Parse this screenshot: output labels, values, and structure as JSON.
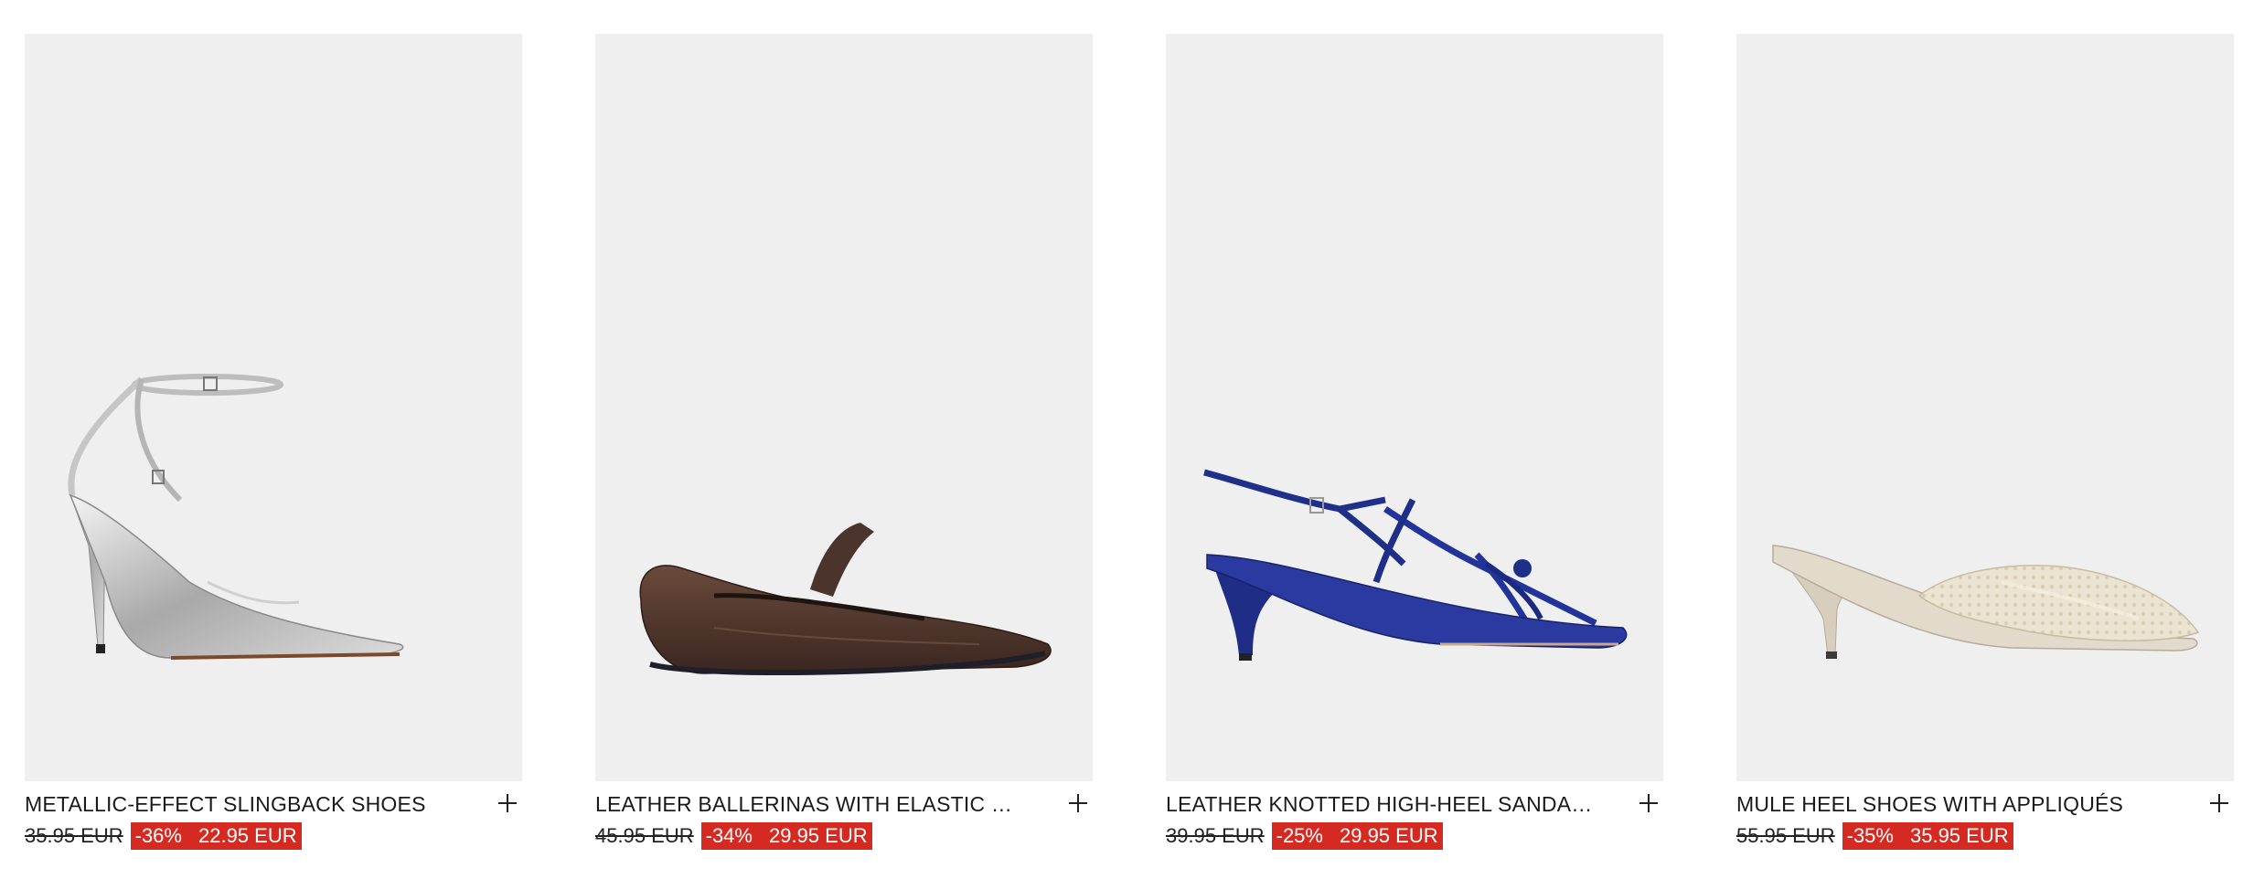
{
  "products": [
    {
      "name": "METALLIC-EFFECT SLINGBACK SHOES",
      "old_price": "35.95 EUR",
      "discount": "-36%",
      "new_price": "22.95 EUR",
      "image_icon": "silver-slingback-shoe"
    },
    {
      "name": "LEATHER BALLERINAS WITH ELASTIC ST...",
      "old_price": "45.95 EUR",
      "discount": "-34%",
      "new_price": "29.95 EUR",
      "image_icon": "brown-ballerina-shoe"
    },
    {
      "name": "LEATHER KNOTTED HIGH-HEEL SANDALS",
      "old_price": "39.95 EUR",
      "discount": "-25%",
      "new_price": "29.95 EUR",
      "image_icon": "blue-strappy-sandal"
    },
    {
      "name": "MULE HEEL SHOES WITH APPLIQUÉS",
      "old_price": "55.95 EUR",
      "discount": "-35%",
      "new_price": "35.95 EUR",
      "image_icon": "cream-mule-shoe"
    }
  ],
  "colors": {
    "image_background": "#efefef",
    "sale_badge": "#d42a22",
    "text": "#1a1a1a"
  }
}
